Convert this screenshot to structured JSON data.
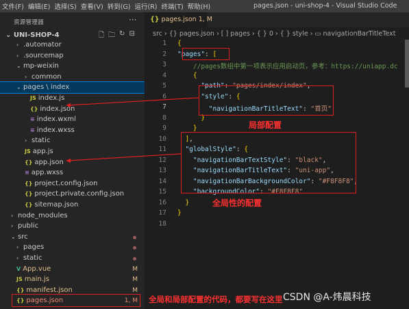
{
  "menu": {
    "items": [
      "文件(F)",
      "编辑(E)",
      "选择(S)",
      "查看(V)",
      "转到(G)",
      "运行(R)",
      "终端(T)",
      "帮助(H)"
    ],
    "title": "pages.json - uni-shop-4 - Visual Studio Code"
  },
  "sidebar": {
    "title": "资源管理器",
    "more": "···",
    "project": "UNI-SHOP-4",
    "items": [
      {
        "label": ".automator",
        "chev": "›"
      },
      {
        "label": ".sourcemap",
        "chev": "›"
      },
      {
        "label": "mp-weixin",
        "chev": "⌄"
      },
      {
        "label": "common",
        "chev": "›"
      },
      {
        "label": "pages \\ index",
        "chev": "⌄"
      },
      {
        "label": "index.js",
        "icon": "JS"
      },
      {
        "label": "index.json",
        "icon": "{}"
      },
      {
        "label": "index.wxml",
        "icon": "≡"
      },
      {
        "label": "index.wxss",
        "icon": "≡"
      },
      {
        "label": "static",
        "chev": "›"
      },
      {
        "label": "app.js",
        "icon": "JS"
      },
      {
        "label": "app.json",
        "icon": "{}"
      },
      {
        "label": "app.wxss",
        "icon": "≡"
      },
      {
        "label": "project.config.json",
        "icon": "{}"
      },
      {
        "label": "project.private.config.json",
        "icon": "{}"
      },
      {
        "label": "sitemap.json",
        "icon": "{}"
      },
      {
        "label": "node_modules",
        "chev": "›"
      },
      {
        "label": "public",
        "chev": "›"
      },
      {
        "label": "src",
        "chev": "⌄"
      },
      {
        "label": "pages",
        "chev": "›"
      },
      {
        "label": "static",
        "chev": "›"
      },
      {
        "label": "App.vue",
        "icon": "V",
        "badge": "M"
      },
      {
        "label": "main.js",
        "icon": "JS",
        "badge": "M"
      },
      {
        "label": "manifest.json",
        "icon": "{}",
        "badge": "M"
      },
      {
        "label": "pages.json",
        "icon": "{}",
        "badge": "1, M"
      }
    ]
  },
  "editor": {
    "tab": {
      "label": "pages.json",
      "status": "1, M",
      "icon": "{}"
    },
    "breadcrumb": "src › {} pages.json › [ ] pages › { } 0 › { } style › ▭ navigationBarTitleText",
    "lines": [
      {
        "n": "1",
        "tokens": [
          [
            "p",
            "{"
          ]
        ]
      },
      {
        "n": "2",
        "tokens": [
          [
            "k",
            "\"pages\""
          ],
          [
            "pu",
            ": "
          ],
          [
            "p",
            "["
          ]
        ]
      },
      {
        "n": "3",
        "tokens": [
          [
            "c",
            "    //pages数组中第一项表示应用启动页，参考：https://uniapp.dc"
          ]
        ]
      },
      {
        "n": "4",
        "tokens": [
          [
            "p",
            "    {"
          ]
        ]
      },
      {
        "n": "5",
        "tokens": [
          [
            "k",
            "      \"path\""
          ],
          [
            "pu",
            ": "
          ],
          [
            "s",
            "\"pages/index/index\""
          ],
          [
            "pu",
            ","
          ]
        ]
      },
      {
        "n": "6",
        "tokens": [
          [
            "k",
            "      \"style\""
          ],
          [
            "pu",
            ": "
          ],
          [
            "p",
            "{"
          ]
        ]
      },
      {
        "n": "7",
        "tokens": [
          [
            "k",
            "        \"navigationBarTitleText\""
          ],
          [
            "pu",
            ": "
          ],
          [
            "s",
            "\"首页\""
          ]
        ]
      },
      {
        "n": "8",
        "tokens": [
          [
            "p",
            "      }"
          ]
        ]
      },
      {
        "n": "9",
        "tokens": [
          [
            "p",
            "    }"
          ]
        ]
      },
      {
        "n": "10",
        "tokens": [
          [
            "p",
            "  ]"
          ],
          [
            "pu",
            ","
          ]
        ]
      },
      {
        "n": "11",
        "tokens": [
          [
            "k",
            "  \"globalStyle\""
          ],
          [
            "pu",
            ": "
          ],
          [
            "p",
            "{"
          ]
        ]
      },
      {
        "n": "12",
        "tokens": [
          [
            "k",
            "    \"navigationBarTextStyle\""
          ],
          [
            "pu",
            ": "
          ],
          [
            "s",
            "\"black\""
          ],
          [
            "pu",
            ","
          ]
        ]
      },
      {
        "n": "13",
        "tokens": [
          [
            "k",
            "    \"navigationBarTitleText\""
          ],
          [
            "pu",
            ": "
          ],
          [
            "s",
            "\"uni-app\""
          ],
          [
            "pu",
            ","
          ]
        ]
      },
      {
        "n": "14",
        "tokens": [
          [
            "k",
            "    \"navigationBarBackgroundColor\""
          ],
          [
            "pu",
            ": "
          ],
          [
            "s",
            "\"#F8F8F8\""
          ],
          [
            "pu",
            ","
          ]
        ]
      },
      {
        "n": "15",
        "tokens": [
          [
            "k",
            "    \"backgroundColor\""
          ],
          [
            "pu",
            ": "
          ],
          [
            "s",
            "\"#F8F8F8\""
          ]
        ]
      },
      {
        "n": "16",
        "tokens": [
          [
            "p",
            "  }"
          ]
        ]
      },
      {
        "n": "17",
        "tokens": [
          [
            "p",
            "}"
          ]
        ]
      },
      {
        "n": "18",
        "tokens": []
      }
    ]
  },
  "annotations": {
    "local": "局部配置",
    "global": "全局性的配置",
    "bottom": "全局和局部配置的代码，都要写在这里"
  },
  "watermark": "CSDN @A-炜晨科技",
  "colors": {
    "accent": "#007fd4",
    "annotation": "#ff3030",
    "json_key": "#9cdcfe",
    "json_string": "#ce9178",
    "comment": "#6a9955",
    "modified": "#e2c08d"
  }
}
